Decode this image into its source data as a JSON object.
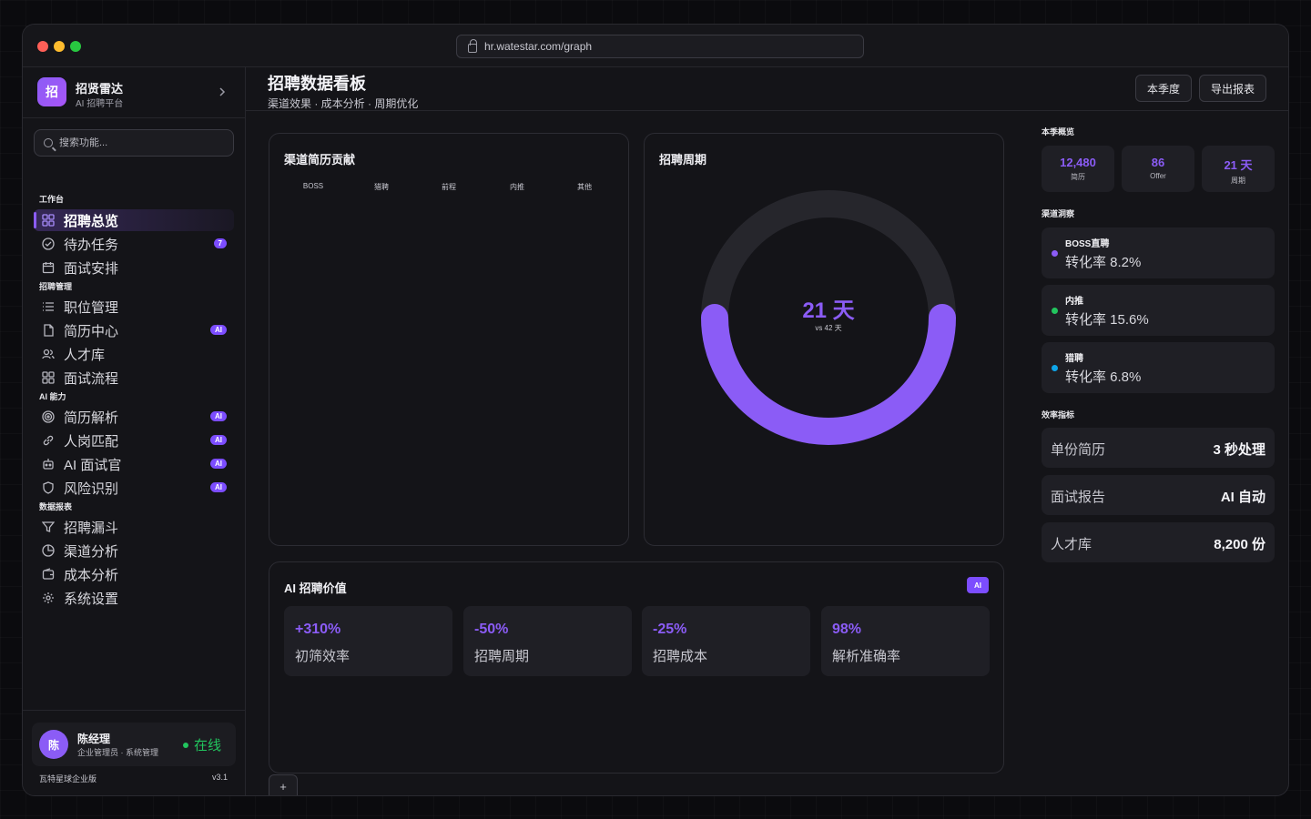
{
  "browser": {
    "url": "hr.watestar.com/graph"
  },
  "brand": {
    "logo_char": "招",
    "name": "招贤雷达",
    "subtitle": "AI 招聘平台"
  },
  "search": {
    "placeholder": "搜索功能..."
  },
  "nav": {
    "sections": [
      {
        "label": "工作台"
      },
      {
        "label": "招聘管理"
      },
      {
        "label": "AI 能力"
      },
      {
        "label": "数据报表"
      }
    ],
    "items": [
      {
        "label": "招聘总览",
        "icon": "grid-icon",
        "active": true
      },
      {
        "label": "待办任务",
        "icon": "check-circle-icon",
        "badge": "7"
      },
      {
        "label": "面试安排",
        "icon": "calendar-icon"
      },
      {
        "label": "职位管理",
        "icon": "list-icon"
      },
      {
        "label": "简历中心",
        "icon": "document-icon",
        "badge": "AI"
      },
      {
        "label": "人才库",
        "icon": "users-icon"
      },
      {
        "label": "面试流程",
        "icon": "grid-icon"
      },
      {
        "label": "简历解析",
        "icon": "target-icon",
        "badge": "AI"
      },
      {
        "label": "人岗匹配",
        "icon": "link-icon",
        "badge": "AI"
      },
      {
        "label": "AI 面试官",
        "icon": "robot-icon",
        "badge": "AI"
      },
      {
        "label": "风险识别",
        "icon": "shield-icon",
        "badge": "AI"
      },
      {
        "label": "招聘漏斗",
        "icon": "funnel-icon"
      },
      {
        "label": "渠道分析",
        "icon": "pie-icon"
      },
      {
        "label": "成本分析",
        "icon": "wallet-icon"
      },
      {
        "label": "系统设置",
        "icon": "gear-icon"
      }
    ]
  },
  "user": {
    "avatar_char": "陈",
    "name": "陈经理",
    "role": "企业管理员 · 系统管理",
    "status": "在线"
  },
  "footer": {
    "edition": "瓦特星球企业版",
    "version": "v3.1"
  },
  "header": {
    "title": "招聘数据看板",
    "subtitle": "渠道效果 · 成本分析 · 周期优化",
    "buttons": [
      "本季度",
      "导出报表"
    ]
  },
  "channel_card": {
    "title": "渠道简历贡献",
    "channels": [
      "BOSS",
      "猎聘",
      "前程",
      "内推",
      "其他"
    ]
  },
  "cycle_card": {
    "title": "招聘周期",
    "value": "21 天",
    "compare": "vs 42 天",
    "progress": 0.5
  },
  "ai_card": {
    "title": "AI 招聘价值",
    "badge": "AI",
    "metrics": [
      {
        "value": "+310%",
        "label": "初筛效率"
      },
      {
        "value": "-50%",
        "label": "招聘周期"
      },
      {
        "value": "-25%",
        "label": "招聘成本"
      },
      {
        "value": "98%",
        "label": "解析准确率"
      }
    ]
  },
  "add_button": "+",
  "right_panel": {
    "overview_label": "本季概览",
    "stats": [
      {
        "value": "12,480",
        "label": "简历"
      },
      {
        "value": "86",
        "label": "Offer"
      },
      {
        "value": "21 天",
        "label": "周期"
      }
    ],
    "channel_label": "渠道洞察",
    "channels": [
      {
        "name": "BOSS直聘",
        "rate": "转化率 8.2%",
        "color": "#8b5cf6"
      },
      {
        "name": "内推",
        "rate": "转化率 15.6%",
        "color": "#22c55e"
      },
      {
        "name": "猎聘",
        "rate": "转化率 6.8%",
        "color": "#0ea5e9"
      }
    ],
    "efficiency_label": "效率指标",
    "efficiency": [
      {
        "label": "单份简历",
        "value": "3 秒处理"
      },
      {
        "label": "面试报告",
        "value": "AI 自动"
      },
      {
        "label": "人才库",
        "value": "8,200 份"
      }
    ]
  },
  "colors": {
    "accent": "#8b5cf6",
    "background": "#141418",
    "card": "#1f1f25"
  }
}
